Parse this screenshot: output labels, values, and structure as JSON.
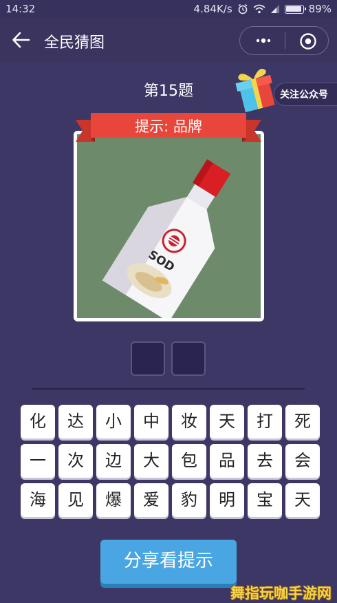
{
  "status_bar": {
    "time": "14:32",
    "net_speed": "4.84K/s",
    "battery": "89%",
    "icons": [
      "alarm-icon",
      "wifi-icon",
      "signal-icon",
      "battery-icon"
    ]
  },
  "nav": {
    "back_icon": "arrow-left-icon",
    "title": "全民猜图",
    "more_icon": "more-dots-icon",
    "close_icon": "target-circle-icon"
  },
  "question": {
    "number": "第15题",
    "hint": "提示: 品牌",
    "image_text": "SOD"
  },
  "follow": {
    "label": "关注公众号",
    "icon": "gift-box-icon"
  },
  "answer_slots": [
    "",
    ""
  ],
  "keyboard": {
    "rows": [
      [
        "化",
        "达",
        "小",
        "中",
        "妆",
        "天",
        "打",
        "死"
      ],
      [
        "一",
        "次",
        "边",
        "大",
        "包",
        "品",
        "去",
        "会"
      ],
      [
        "海",
        "见",
        "爆",
        "爱",
        "豹",
        "明",
        "宝",
        "天"
      ]
    ]
  },
  "share_button": "分享看提示",
  "watermark": "舞指玩咖手游网",
  "colors": {
    "background": "#3d3766",
    "ribbon": "#e8463a",
    "image_bg": "#6d8a6b",
    "share_button": "#4aa6e2"
  }
}
